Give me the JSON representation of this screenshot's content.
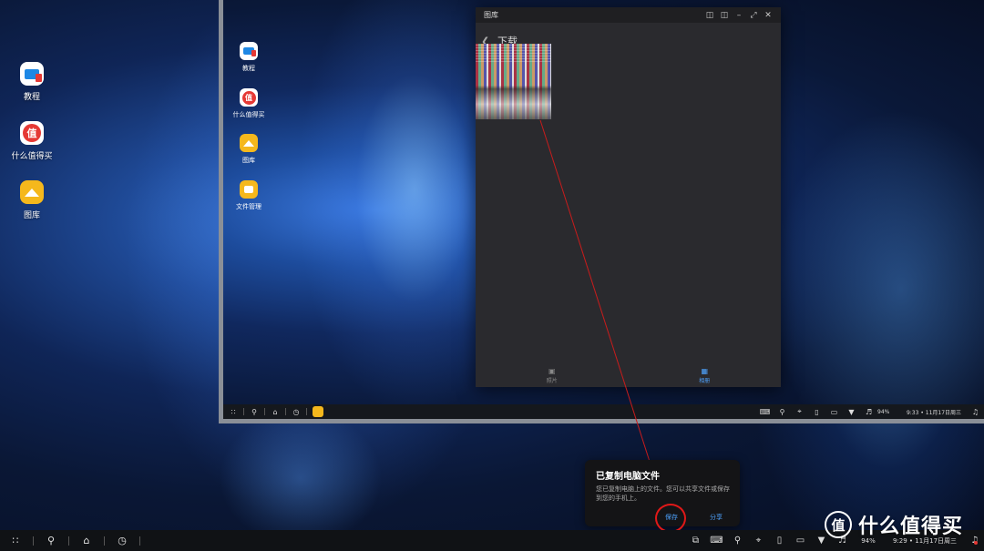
{
  "desktop": {
    "icons": [
      {
        "label": "教程",
        "icon": "tutorial-icon"
      },
      {
        "label": "什么值得买",
        "icon": "zdm-icon"
      },
      {
        "label": "图库",
        "icon": "gallery-icon"
      }
    ]
  },
  "remote_screen": {
    "icons": [
      {
        "label": "教程",
        "icon": "tutorial-icon"
      },
      {
        "label": "什么值得买",
        "icon": "zdm-icon"
      },
      {
        "label": "图库",
        "icon": "gallery-icon"
      },
      {
        "label": "文件管理",
        "icon": "files-icon"
      }
    ],
    "gallery_window": {
      "title": "图库",
      "folder_title": "下载",
      "nav": [
        {
          "label": "照片",
          "icon": "photos-icon",
          "active": false
        },
        {
          "label": "相册",
          "icon": "albums-icon",
          "active": true
        }
      ]
    },
    "taskbar": {
      "battery": "94%",
      "clock": "9:33 • 11月17日周三"
    }
  },
  "notification": {
    "title": "已复制电脑文件",
    "body": "您已复制电脑上的文件。您可以共享文件或保存到您的手机上。",
    "save_label": "保存",
    "share_label": "分享"
  },
  "taskbar": {
    "battery": "94%",
    "clock": "9:29 • 11月17日周三"
  },
  "watermark": {
    "logo_char": "值",
    "text": "什么值得买"
  },
  "colors": {
    "accent": "#4ea3ff",
    "annotation": "#e01818",
    "gallery_yellow": "#f5b81c"
  }
}
